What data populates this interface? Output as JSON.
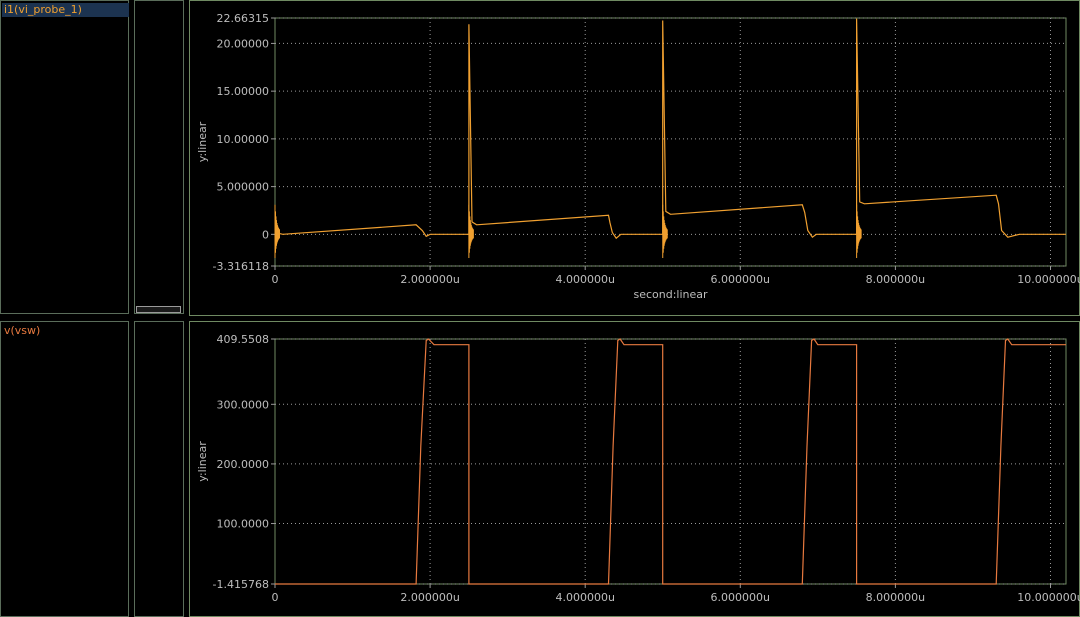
{
  "colors": {
    "background": "#000000",
    "frame": "#6f8a62",
    "grid": "#9a9a9a",
    "text": "#bdbdbd",
    "trace_current": "#f0a030",
    "trace_voltage": "#e7793f",
    "label_highlight": "#1c3350"
  },
  "signals": {
    "top": "i1(vi_probe_1)",
    "bottom": "v(vsw)"
  },
  "chart_data": [
    {
      "type": "line",
      "name": "current-plot",
      "series_name": "i1(vi_probe_1)",
      "xlabel": "second:linear",
      "ylabel": "y:linear",
      "xlim": [
        0,
        10.2
      ],
      "ylim": [
        -3.316118,
        22.66315
      ],
      "x_ticks": [
        0,
        2,
        4,
        6,
        8,
        10
      ],
      "x_tick_labels": [
        "0",
        "2.000000u",
        "4.000000u",
        "6.000000u",
        "8.000000u",
        "10.000000u"
      ],
      "y_ticks": [
        -3.316118,
        0,
        5,
        10,
        15,
        20,
        22.66315
      ],
      "y_tick_labels": [
        "-3.316118",
        "0",
        "5.000000",
        "10.00000",
        "15.00000",
        "20.00000",
        "22.66315"
      ],
      "grid": true,
      "x": [
        0,
        0.02,
        0.05,
        0.1,
        1.82,
        1.9,
        1.95,
        2.0,
        2.5,
        2.5,
        2.54,
        2.6,
        4.3,
        4.32,
        4.35,
        4.4,
        4.46,
        5.0,
        5.0,
        5.04,
        5.1,
        6.8,
        6.83,
        6.87,
        6.93,
        6.98,
        7.5,
        7.5,
        7.54,
        7.6,
        9.3,
        9.33,
        9.37,
        9.45,
        9.6,
        10.2
      ],
      "y": [
        0,
        -0.3,
        0.1,
        0,
        1.0,
        0.4,
        -0.2,
        0,
        0,
        22.0,
        1.3,
        1.0,
        2.0,
        1.2,
        0.2,
        -0.4,
        0,
        0,
        22.4,
        2.4,
        2.1,
        3.1,
        2.3,
        0.4,
        -0.3,
        0,
        0,
        22.6,
        3.4,
        3.2,
        4.1,
        3.2,
        0.4,
        -0.3,
        0,
        0
      ]
    },
    {
      "type": "line",
      "name": "voltage-plot",
      "series_name": "v(vsw)",
      "xlabel": "",
      "ylabel": "y:linear",
      "xlim": [
        0,
        10.2
      ],
      "ylim": [
        -1.415768,
        409.5508
      ],
      "x_ticks": [
        0,
        2,
        4,
        6,
        8,
        10
      ],
      "x_tick_labels": [
        "0",
        "2.000000u",
        "4.000000u",
        "6.000000u",
        "8.000000u",
        "10.000000u"
      ],
      "y_ticks": [
        -1.415768,
        100,
        200,
        300,
        409.5508
      ],
      "y_tick_labels": [
        "-1.415768",
        "100.0000",
        "200.0000",
        "300.0000",
        "409.5508"
      ],
      "grid": true,
      "x": [
        0,
        1.82,
        1.88,
        1.95,
        1.98,
        2.05,
        2.5,
        2.5,
        4.3,
        4.36,
        4.42,
        4.45,
        4.5,
        5.0,
        5.0,
        6.8,
        6.86,
        6.92,
        6.95,
        7.0,
        7.5,
        7.5,
        9.3,
        9.36,
        9.42,
        9.45,
        9.5,
        10.2
      ],
      "y": [
        -1.4,
        -1.4,
        230,
        407,
        409.5,
        400,
        400,
        -1.4,
        -1.4,
        230,
        407,
        409.5,
        400,
        400,
        -1.4,
        -1.4,
        230,
        407,
        409.5,
        400,
        400,
        -1.4,
        -1.4,
        230,
        407,
        409.5,
        400,
        400
      ]
    }
  ]
}
